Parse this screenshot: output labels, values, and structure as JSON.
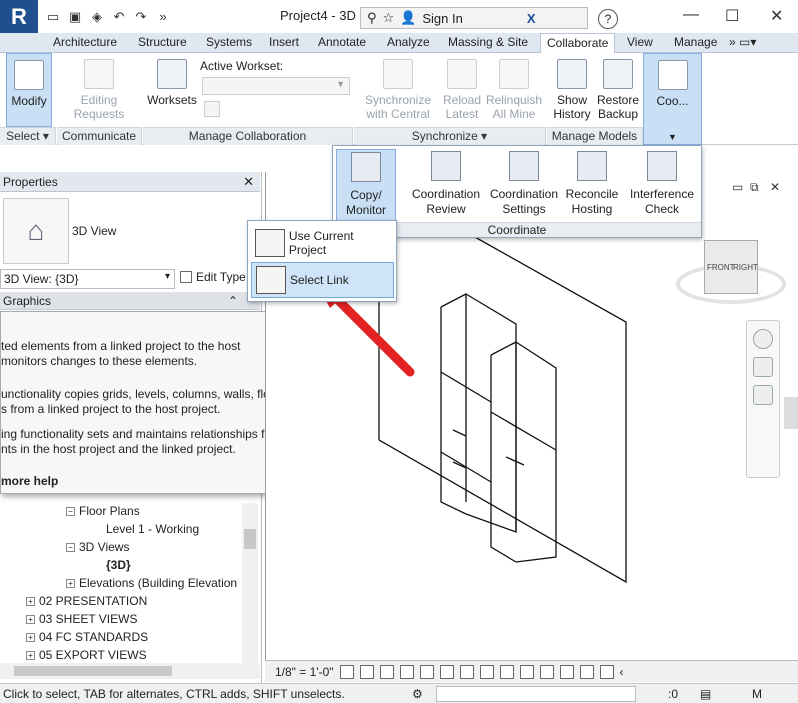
{
  "window": {
    "title": "Project4 - 3D ...",
    "sign_in": "Sign In",
    "help": "?"
  },
  "ribbon_tabs": [
    "Architecture",
    "Structure",
    "Systems",
    "Insert",
    "Annotate",
    "Analyze",
    "Massing & Site",
    "Collaborate",
    "View",
    "Manage"
  ],
  "active_tab": "Collaborate",
  "ribbon": {
    "modify": "Modify",
    "select_panel": "Select",
    "editing_requests": [
      "Editing",
      "Requests"
    ],
    "communicate_panel": "Communicate",
    "worksets": "Worksets",
    "active_workset_label": "Active Workset:",
    "manage_collaboration_panel": "Manage Collaboration",
    "sync_central": [
      "Synchronize",
      "with Central"
    ],
    "reload_latest": [
      "Reload",
      "Latest"
    ],
    "relinquish_all": [
      "Relinquish",
      "All Mine"
    ],
    "synchronize_panel": "Synchronize",
    "show_history": [
      "Show",
      "History"
    ],
    "restore_backup": [
      "Restore",
      "Backup"
    ],
    "manage_models_panel": "Manage Models",
    "coo": "Coo..."
  },
  "coordinate_panel": {
    "buttons": [
      [
        "Copy/",
        "Monitor"
      ],
      [
        "Coordination",
        "Review"
      ],
      [
        "Coordination",
        "Settings"
      ],
      [
        "Reconcile",
        "Hosting"
      ],
      [
        "Interference",
        "Check"
      ]
    ],
    "label": "Coordinate"
  },
  "menu": {
    "use_current": "Use Current Project",
    "select_link": "Select Link"
  },
  "properties": {
    "title": "Properties",
    "type_name": "3D View",
    "view_selector": "3D View: {3D}",
    "edit_type": "Edit Type",
    "graphics": "Graphics"
  },
  "tooltip": {
    "lines": [
      "ted elements from a linked project to the host",
      "monitors changes to these elements.",
      "unctionality copies grids, levels, columns, walls, floors,",
      "s from a linked project to the host project.",
      "ing functionality sets and maintains relationships for",
      "nts in the host project and the linked project."
    ],
    "more_help": "more help"
  },
  "tree": {
    "floor_plans": "Floor Plans",
    "level1": "Level 1 - Working",
    "views_3d": "3D Views",
    "view_3d": "{3D}",
    "elevations": "Elevations (Building Elevation",
    "presentation": "02 PRESENTATION",
    "sheet_views": "03 SHEET VIEWS",
    "fc_standards": "04 FC STANDARDS",
    "export_views": "05 EXPORT VIEWS"
  },
  "viewcube": {
    "front": "FRONT",
    "right": "RIGHT"
  },
  "view_bar": {
    "scale": "1/8\" = 1'-0\""
  },
  "status": {
    "hint": "Click to select, TAB for alternates, CTRL adds, SHIFT unselects.",
    "zero": ":0"
  }
}
